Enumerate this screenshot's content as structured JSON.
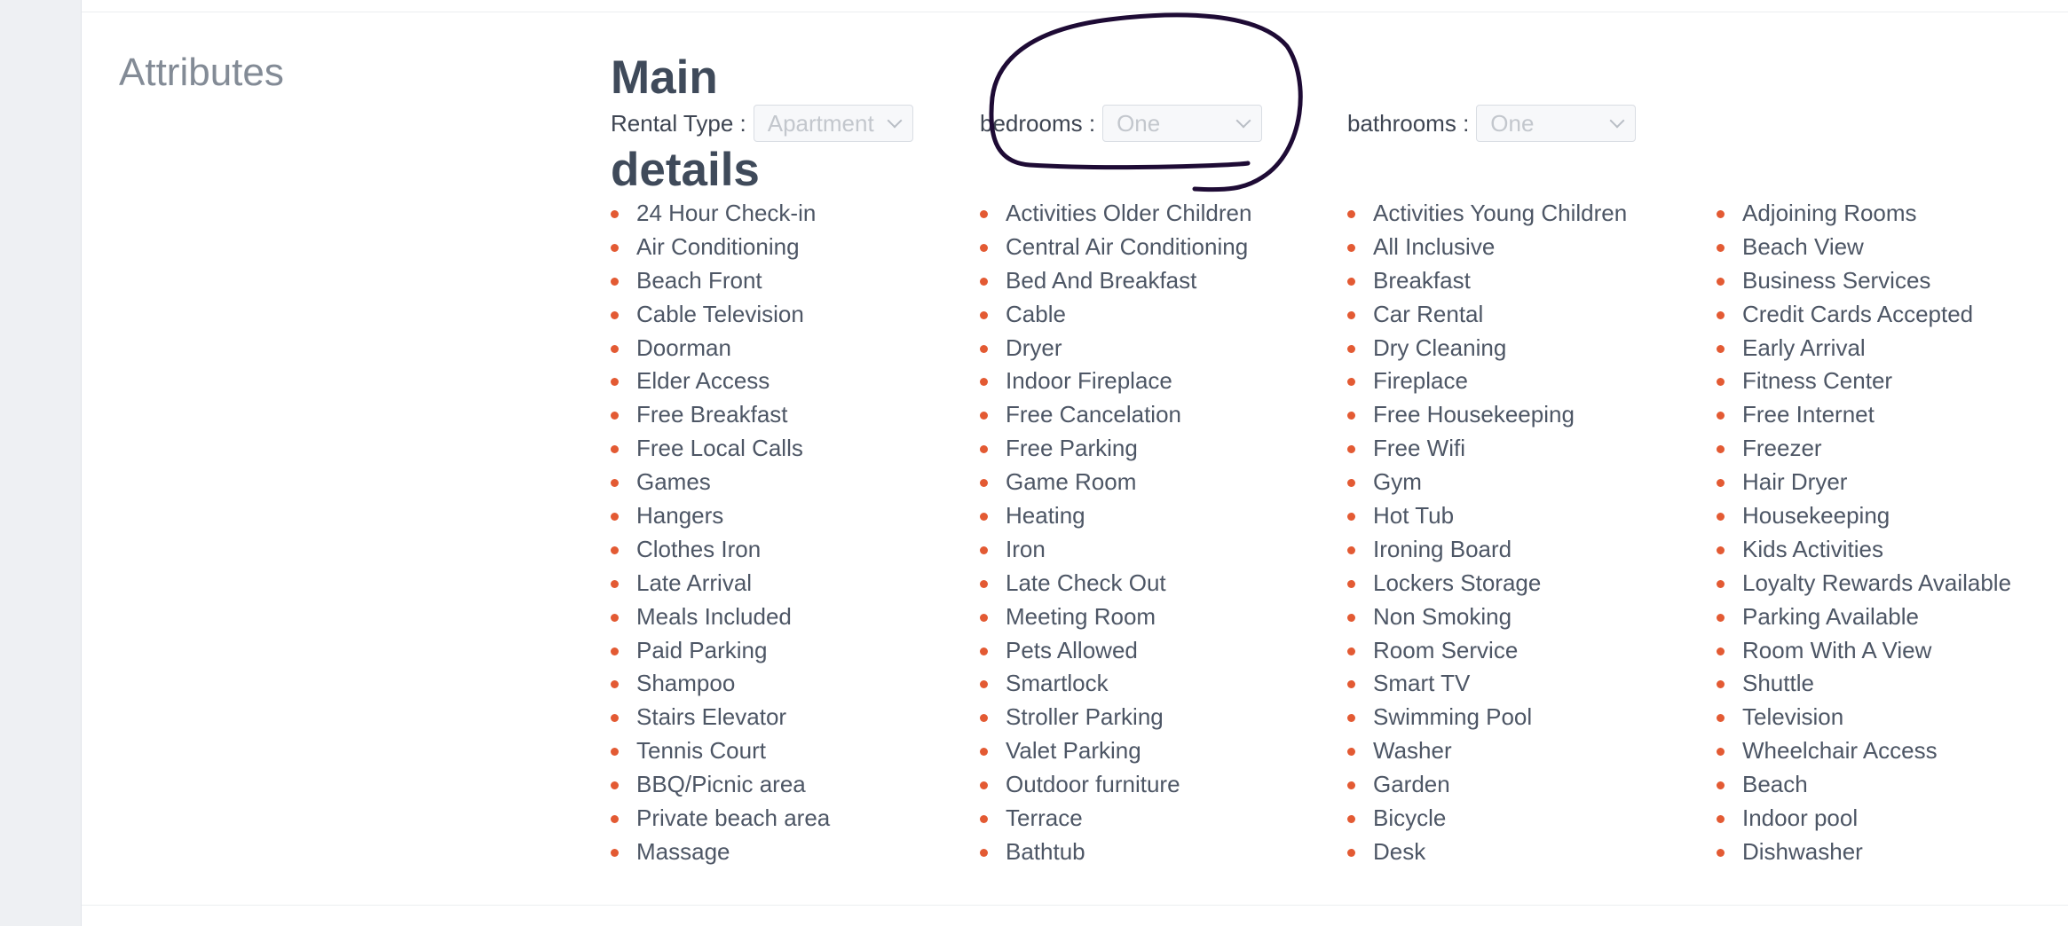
{
  "section_title": "Attributes",
  "headings": {
    "main": "Main",
    "details": "details"
  },
  "fields": {
    "rental_type": {
      "label": "Rental Type :",
      "value": "Apartment"
    },
    "bedrooms": {
      "label": "bedrooms :",
      "value": "One"
    },
    "bathrooms": {
      "label": "bathrooms :",
      "value": "One"
    }
  },
  "annotation": {
    "color": "#1e0b35"
  },
  "colors": {
    "bullet": "#e35a33",
    "heading": "#3f4a5a"
  },
  "attributes": {
    "col1": [
      "24 Hour Check-in",
      "Air Conditioning",
      "Beach Front",
      "Cable Television",
      "Doorman",
      "Elder Access",
      "Free Breakfast",
      "Free Local Calls",
      "Games",
      "Hangers",
      "Clothes Iron",
      "Late Arrival",
      "Meals Included",
      "Paid Parking",
      "Shampoo",
      "Stairs Elevator",
      "Tennis Court",
      "BBQ/Picnic area",
      "Private beach area",
      "Massage"
    ],
    "col2": [
      "Activities Older Children",
      "Central Air Conditioning",
      "Bed And Breakfast",
      "Cable",
      "Dryer",
      "Indoor Fireplace",
      "Free Cancelation",
      "Free Parking",
      "Game Room",
      "Heating",
      "Iron",
      "Late Check Out",
      "Meeting Room",
      "Pets Allowed",
      "Smartlock",
      "Stroller Parking",
      "Valet Parking",
      "Outdoor furniture",
      "Terrace",
      "Bathtub"
    ],
    "col3": [
      "Activities Young Children",
      "All Inclusive",
      "Breakfast",
      "Car Rental",
      "Dry Cleaning",
      "Fireplace",
      "Free Housekeeping",
      "Free Wifi",
      "Gym",
      "Hot Tub",
      "Ironing Board",
      "Lockers Storage",
      "Non Smoking",
      "Room Service",
      "Smart TV",
      "Swimming Pool",
      "Washer",
      "Garden",
      "Bicycle",
      "Desk"
    ],
    "col4": [
      "Adjoining Rooms",
      "Beach View",
      "Business Services",
      "Credit Cards Accepted",
      "Early Arrival",
      "Fitness Center",
      "Free Internet",
      "Freezer",
      "Hair Dryer",
      "Housekeeping",
      "Kids Activities",
      "Loyalty Rewards Available",
      "Parking Available",
      "Room With A View",
      "Shuttle",
      "Television",
      "Wheelchair Access",
      "Beach",
      "Indoor pool",
      "Dishwasher"
    ]
  }
}
